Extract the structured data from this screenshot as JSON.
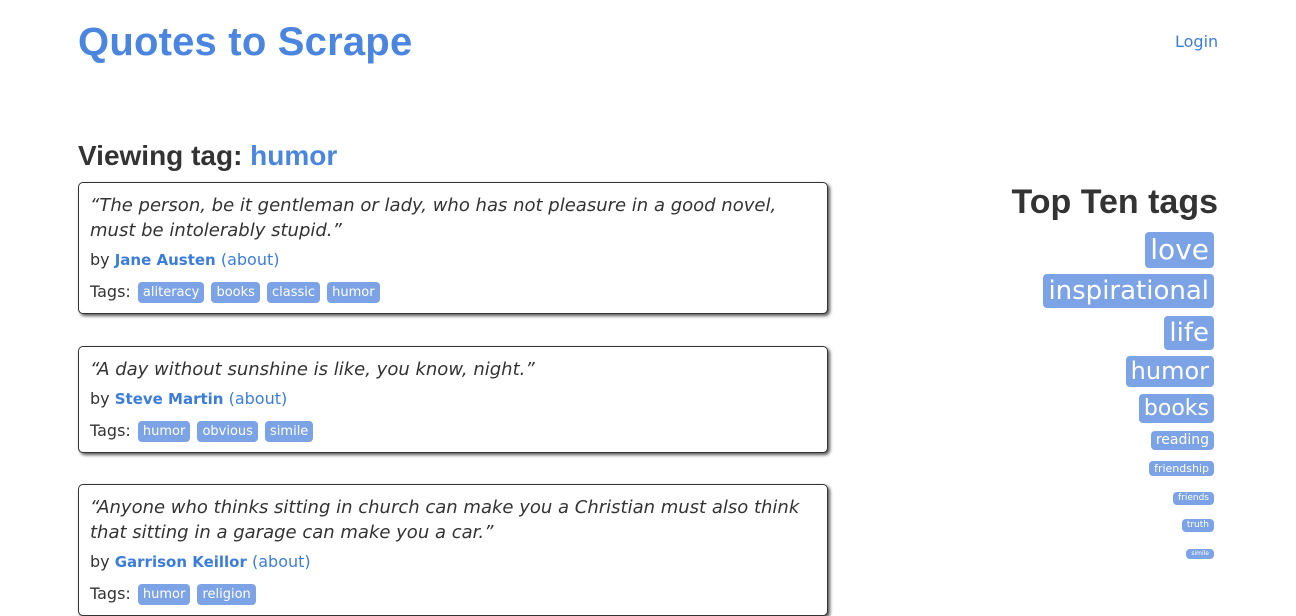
{
  "header": {
    "site_title": "Quotes to Scrape",
    "login_label": "Login"
  },
  "page": {
    "viewing_prefix": "Viewing tag:",
    "current_tag": "humor"
  },
  "quotes": [
    {
      "text": "“The person, be it gentleman or lady, who has not pleasure in a good novel, must be intolerably stupid.”",
      "by_prefix": "by",
      "author": "Jane Austen",
      "about_label": "(about)",
      "tags_label": "Tags:",
      "tags": [
        "aliteracy",
        "books",
        "classic",
        "humor"
      ]
    },
    {
      "text": "“A day without sunshine is like, you know, night.”",
      "by_prefix": "by",
      "author": "Steve Martin",
      "about_label": "(about)",
      "tags_label": "Tags:",
      "tags": [
        "humor",
        "obvious",
        "simile"
      ]
    },
    {
      "text": "“Anyone who thinks sitting in church can make you a Christian must also think that sitting in a garage can make you a car.”",
      "by_prefix": "by",
      "author": "Garrison Keillor",
      "about_label": "(about)",
      "tags_label": "Tags:",
      "tags": [
        "humor",
        "religion"
      ]
    }
  ],
  "sidebar": {
    "title": "Top Ten tags",
    "tags": [
      "love",
      "inspirational",
      "life",
      "humor",
      "books",
      "reading",
      "friendship",
      "friends",
      "truth",
      "simile"
    ]
  },
  "colors": {
    "accent": "#4a85e0",
    "link": "#3b7ddd",
    "tag_bg": "#7ca3e6",
    "text": "#333333"
  }
}
